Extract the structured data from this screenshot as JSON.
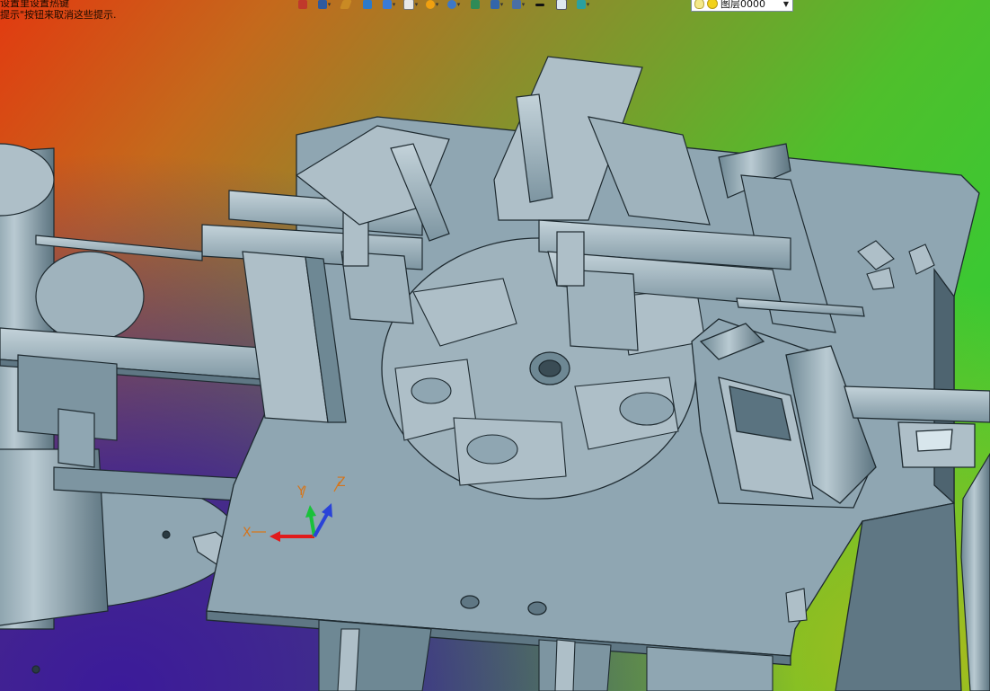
{
  "hints": {
    "line1": "设置里设置热键",
    "line2": "提示\"按钮来取消这些提示."
  },
  "toolbar": {
    "buttons": [
      {
        "name": "insert-icon",
        "color": "#c0392b"
      },
      {
        "name": "view-icon",
        "color": "#2e5a9e"
      },
      {
        "name": "pencil-icon",
        "color": "#c98a24"
      },
      {
        "name": "layers-icon",
        "color": "#2e7ac9"
      },
      {
        "name": "cube-icon",
        "color": "#3a7bd5"
      },
      {
        "name": "box-icon",
        "color": "#e8e8e8"
      },
      {
        "name": "sun-icon",
        "color": "#f0a010"
      },
      {
        "name": "zoom-icon",
        "color": "#3d78c7"
      },
      {
        "name": "page-icon",
        "color": "#2e8b57"
      },
      {
        "name": "render-icon",
        "color": "#3366aa"
      },
      {
        "name": "display-icon",
        "color": "#4a6fa5"
      },
      {
        "name": "linewidth-icon",
        "color": "#111111"
      },
      {
        "name": "sheet-icon",
        "color": "#dfe8f0"
      },
      {
        "name": "color-icon",
        "color": "#2aa0a0"
      }
    ],
    "layer_label": "图层0000"
  },
  "axes": {
    "x": "X",
    "y": "Y",
    "z": "Z"
  },
  "colors": {
    "part_fill": "#8fa6b2",
    "part_light": "#aebfc8",
    "part_dark": "#5f7784",
    "edge": "#1e2a30"
  }
}
